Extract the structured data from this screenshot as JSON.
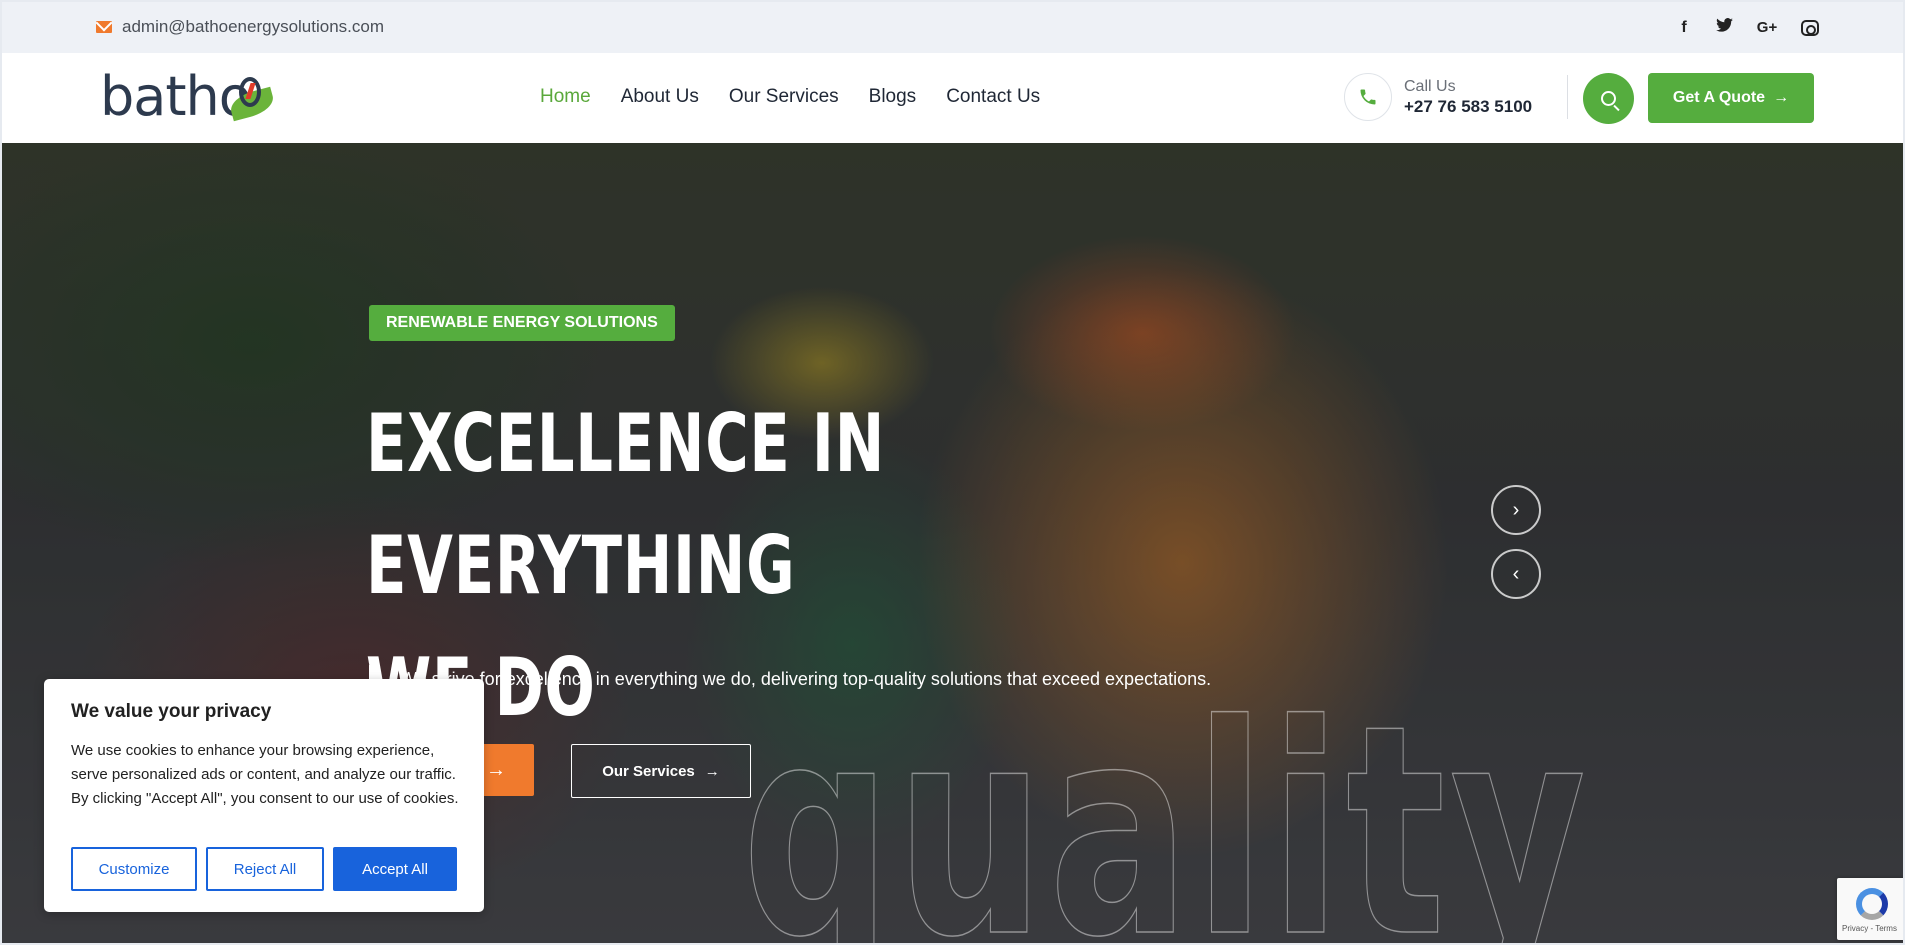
{
  "topbar": {
    "email": "admin@bathoenergysolutions.com",
    "socials": [
      "facebook-icon",
      "twitter-icon",
      "google-plus-icon",
      "instagram-icon"
    ],
    "social_glyphs": {
      "facebook": "f",
      "twitter": "🐦",
      "google": "G+"
    }
  },
  "header": {
    "logo_text": "batho",
    "nav": [
      {
        "label": "Home",
        "active": true
      },
      {
        "label": "About Us",
        "active": false
      },
      {
        "label": "Our Services",
        "active": false
      },
      {
        "label": "Blogs",
        "active": false
      },
      {
        "label": "Contact Us",
        "active": false
      }
    ],
    "call_label": "Call Us",
    "call_number": "+27 76 583 5100",
    "quote_label": "Get A Quote",
    "quote_arrow": "→"
  },
  "hero": {
    "badge": "RENEWABLE ENERGY SOLUTIONS",
    "headline_line1": "EXCELLENCE IN EVERYTHING",
    "headline_line2": "WE DO",
    "subline": "We strive for excellence in everything we do, delivering top-quality solutions that exceed expectations.",
    "btn1_arrow": "→",
    "btn2_label": "Our Services",
    "btn2_arrow": "→",
    "next_arrow": "›",
    "prev_arrow": "‹",
    "outline_word": "quality"
  },
  "cookie": {
    "title": "We value your privacy",
    "text": "We use cookies to enhance your browsing experience, serve personalized ads or content, and analyze our traffic. By clicking \"Accept All\", you consent to our use of cookies.",
    "customize": "Customize",
    "reject": "Reject All",
    "accept": "Accept All"
  },
  "recaptcha": {
    "text": "Privacy - Terms"
  },
  "colors": {
    "brand_green": "#55ad3e",
    "accent_orange": "#f07a2d",
    "cookie_blue": "#1863dc"
  }
}
